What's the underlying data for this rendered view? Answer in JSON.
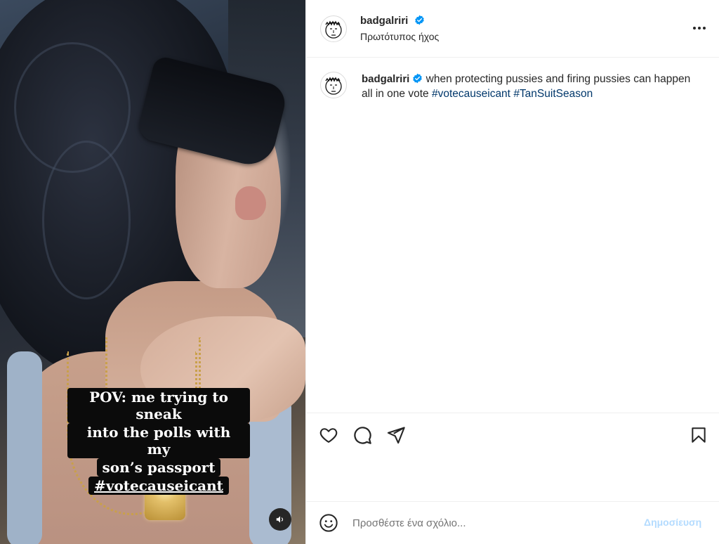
{
  "post": {
    "author": {
      "username": "badgalriri",
      "verified": true,
      "avatar_icon": "doodle-face-avatar-icon"
    },
    "audio_label": "Πρωτότυπος ήχος",
    "media": {
      "overlay_lines": [
        "POV: me trying to sneak",
        "into the polls with my",
        "son’s passport",
        "#votecauseicant"
      ],
      "sound_icon": "speaker-icon"
    },
    "caption": {
      "username": "badgalriri",
      "text": "when protecting pussies and firing pussies can happen all in one vote",
      "hashtags": [
        "#votecauseicant",
        "#TanSuitSeason"
      ]
    },
    "actions": {
      "icons": [
        "heart-icon",
        "comment-icon",
        "share-icon",
        "bookmark-icon"
      ]
    },
    "comment_box": {
      "placeholder": "Προσθέστε ένα σχόλιο...",
      "post_label": "Δημοσίευση",
      "emoji_icon": "emoji-icon"
    },
    "colors": {
      "verified_blue": "#0095f6",
      "hashtag": "#00376b",
      "post_button_disabled": "#b3dbff"
    }
  }
}
